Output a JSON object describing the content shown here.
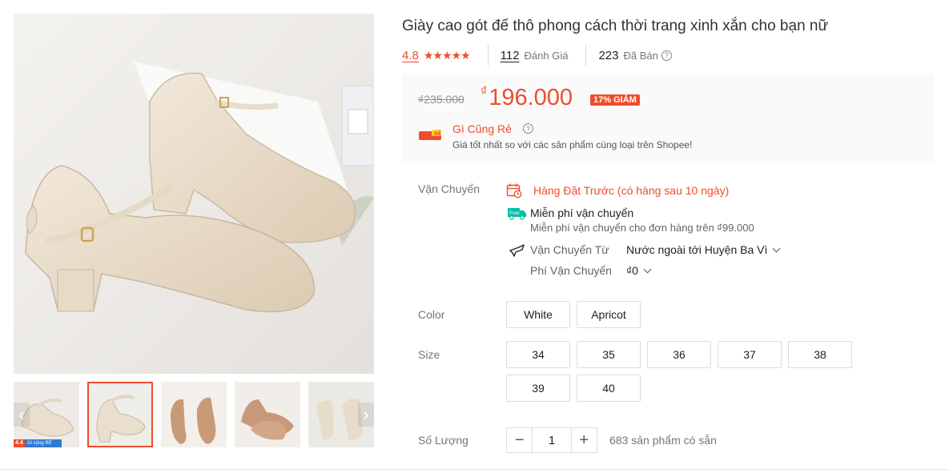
{
  "product": {
    "title": "Giày cao gót đế thô phong cách thời trang xinh xắn cho bạn nữ",
    "rating": "4.8",
    "stars": "★★★★★",
    "reviews_count": "112",
    "reviews_label": "Đánh Giá",
    "sold_count": "223",
    "sold_label": "Đã Bán"
  },
  "price": {
    "original": "₫235.000",
    "currency": "₫",
    "current": "196.000",
    "discount": "17% GIẢM",
    "promo_title": "Gì Cũng Rẻ",
    "promo_desc": "Giá tốt nhất so với các sản phẩm cùng loại trên Shopee!",
    "promo_logo_text": "RẺ"
  },
  "shipping": {
    "label": "Vận Chuyển",
    "preorder": "Hàng Đặt Trước (có hàng sau 10 ngày)",
    "free_badge": "Free",
    "free_title": "Miễn phí vận chuyển",
    "free_desc": "Miễn phí vận chuyển cho đơn hàng trên ₫99.000",
    "from_label": "Vận Chuyển Từ",
    "from_value": "Nước ngoài tới Huyện Ba Vì",
    "fee_label": "Phí Vận Chuyển",
    "fee_value": "₫0"
  },
  "variations": {
    "color_label": "Color",
    "colors": [
      "White",
      "Apricot"
    ],
    "size_label": "Size",
    "sizes": [
      "34",
      "35",
      "36",
      "37",
      "38",
      "39",
      "40"
    ]
  },
  "quantity": {
    "label": "Số Lượng",
    "minus": "−",
    "value": "1",
    "plus": "+",
    "stock": "683 sản phẩm có sẵn"
  },
  "gallery": {
    "badge_main": "4.4",
    "badge_sub": "Gì cũng RẺ",
    "prev": "‹",
    "next": "›"
  },
  "colors": {
    "accent": "#ee4d2d",
    "shoe_cream": "#e9dcc8",
    "shoe_tan": "#c79b7b"
  }
}
